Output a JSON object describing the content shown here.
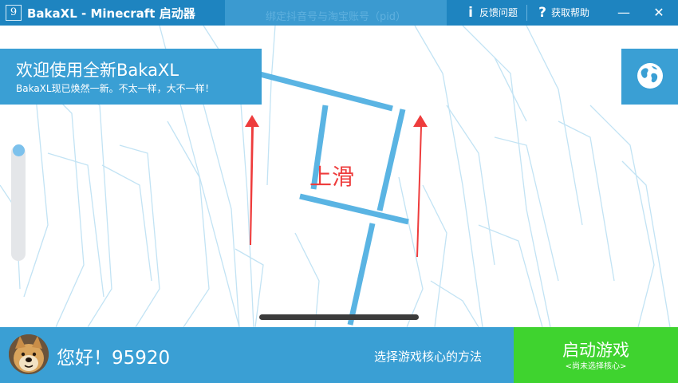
{
  "window": {
    "title": "BakaXL - Minecraft 启动器",
    "logo_glyph": "9",
    "middle_tip": "绑定抖音号与淘宝账号（pid）",
    "feedback_label": "反馈问题",
    "feedback_icon": "info-icon",
    "help_label": "获取帮助",
    "help_icon": "question-icon",
    "minimize_glyph": "—",
    "close_glyph": "✕"
  },
  "welcome": {
    "heading": "欢迎使用全新BakaXL",
    "subtitle": "BakaXL现已焕然一新。不太一样，大不一样！"
  },
  "language_button": {
    "icon": "globe-icon"
  },
  "hint": {
    "text": "上滑"
  },
  "user": {
    "greeting": "您好！95920",
    "avatar": "doge-avatar"
  },
  "footer": {
    "core_method_label": "选择游戏核心的方法"
  },
  "launch": {
    "label": "启动游戏",
    "sublabel": "<尚未选择核心>"
  },
  "colors": {
    "titlebar": "#1e84c0",
    "panel_blue": "#3a9fd4",
    "launch_green": "#3fd32f",
    "hint_red": "#ee3c3c",
    "line_blue": "#5ab4e3"
  }
}
